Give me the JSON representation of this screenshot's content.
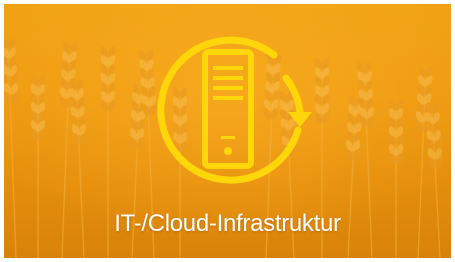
{
  "tile": {
    "caption": "IT-/Cloud-Infrastruktur",
    "icon": "server-sync-icon",
    "background": "wheat-field-photo"
  },
  "colors": {
    "background": "#ee9a10",
    "icon": "#ffd60a",
    "caption_text": "#ffffff"
  }
}
